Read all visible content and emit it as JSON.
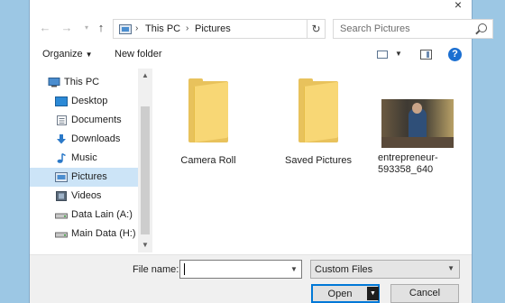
{
  "window": {
    "close_glyph": "×"
  },
  "nav": {
    "back_icon": "back-arrow-icon",
    "forward_icon": "forward-arrow-icon",
    "dropdown_icon": "chevron-down-icon",
    "up_icon": "up-arrow-icon"
  },
  "address": {
    "crumbs": [
      "This PC",
      "Pictures"
    ],
    "separator": "›"
  },
  "search": {
    "placeholder": "Search Pictures"
  },
  "toolbar": {
    "organize_label": "Organize",
    "new_folder_label": "New folder"
  },
  "sidebar": {
    "items": [
      {
        "label": "This PC",
        "icon": "computer-icon"
      },
      {
        "label": "Desktop",
        "icon": "desktop-icon"
      },
      {
        "label": "Documents",
        "icon": "documents-icon"
      },
      {
        "label": "Downloads",
        "icon": "downloads-icon"
      },
      {
        "label": "Music",
        "icon": "music-icon"
      },
      {
        "label": "Pictures",
        "icon": "pictures-icon",
        "selected": true
      },
      {
        "label": "Videos",
        "icon": "videos-icon"
      },
      {
        "label": "Data Lain (A:)",
        "icon": "drive-icon"
      },
      {
        "label": "Main Data (H:)",
        "icon": "drive-icon"
      }
    ]
  },
  "files": [
    {
      "label": "Camera Roll",
      "type": "folder"
    },
    {
      "label": "Saved Pictures",
      "type": "folder"
    },
    {
      "label": "entrepreneur-593358_640",
      "type": "image"
    }
  ],
  "bottom": {
    "file_name_label": "File name:",
    "file_name_value": "",
    "filter_value": "Custom Files",
    "open_label": "Open",
    "cancel_label": "Cancel"
  },
  "colors": {
    "accent": "#0078d7",
    "selection": "#cce4f7",
    "folder": "#f8d775",
    "help": "#1b6fd1"
  }
}
